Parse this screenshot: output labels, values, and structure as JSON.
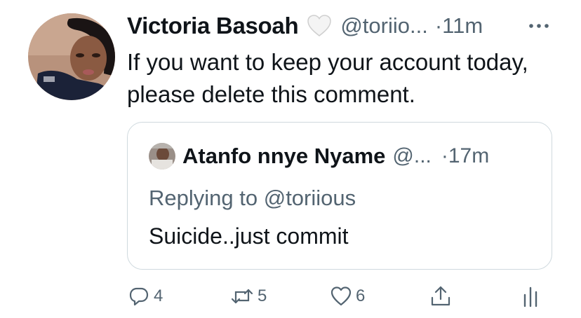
{
  "tweet": {
    "author_name": "Victoria Basoah",
    "handle": "@toriio...",
    "time": "·11m",
    "text": "If you want to keep your account today, please delete this comment.",
    "badge_icon": "white-heart-icon",
    "more_icon": "more-dots-icon"
  },
  "quote": {
    "author_name": "Atanfo nnye Nyame",
    "handle": "@...",
    "time": "·17m",
    "replying_prefix": "Replying to",
    "replying_handle": "@toriious",
    "text": "Suicide..just commit"
  },
  "actions": {
    "reply_count": "4",
    "retweet_count": "5",
    "like_count": "6",
    "icons": [
      "reply-icon",
      "retweet-icon",
      "like-icon",
      "share-icon",
      "analytics-icon"
    ]
  },
  "colors": {
    "text": "#0f1419",
    "secondary": "#536471",
    "border": "#cfd9de"
  }
}
